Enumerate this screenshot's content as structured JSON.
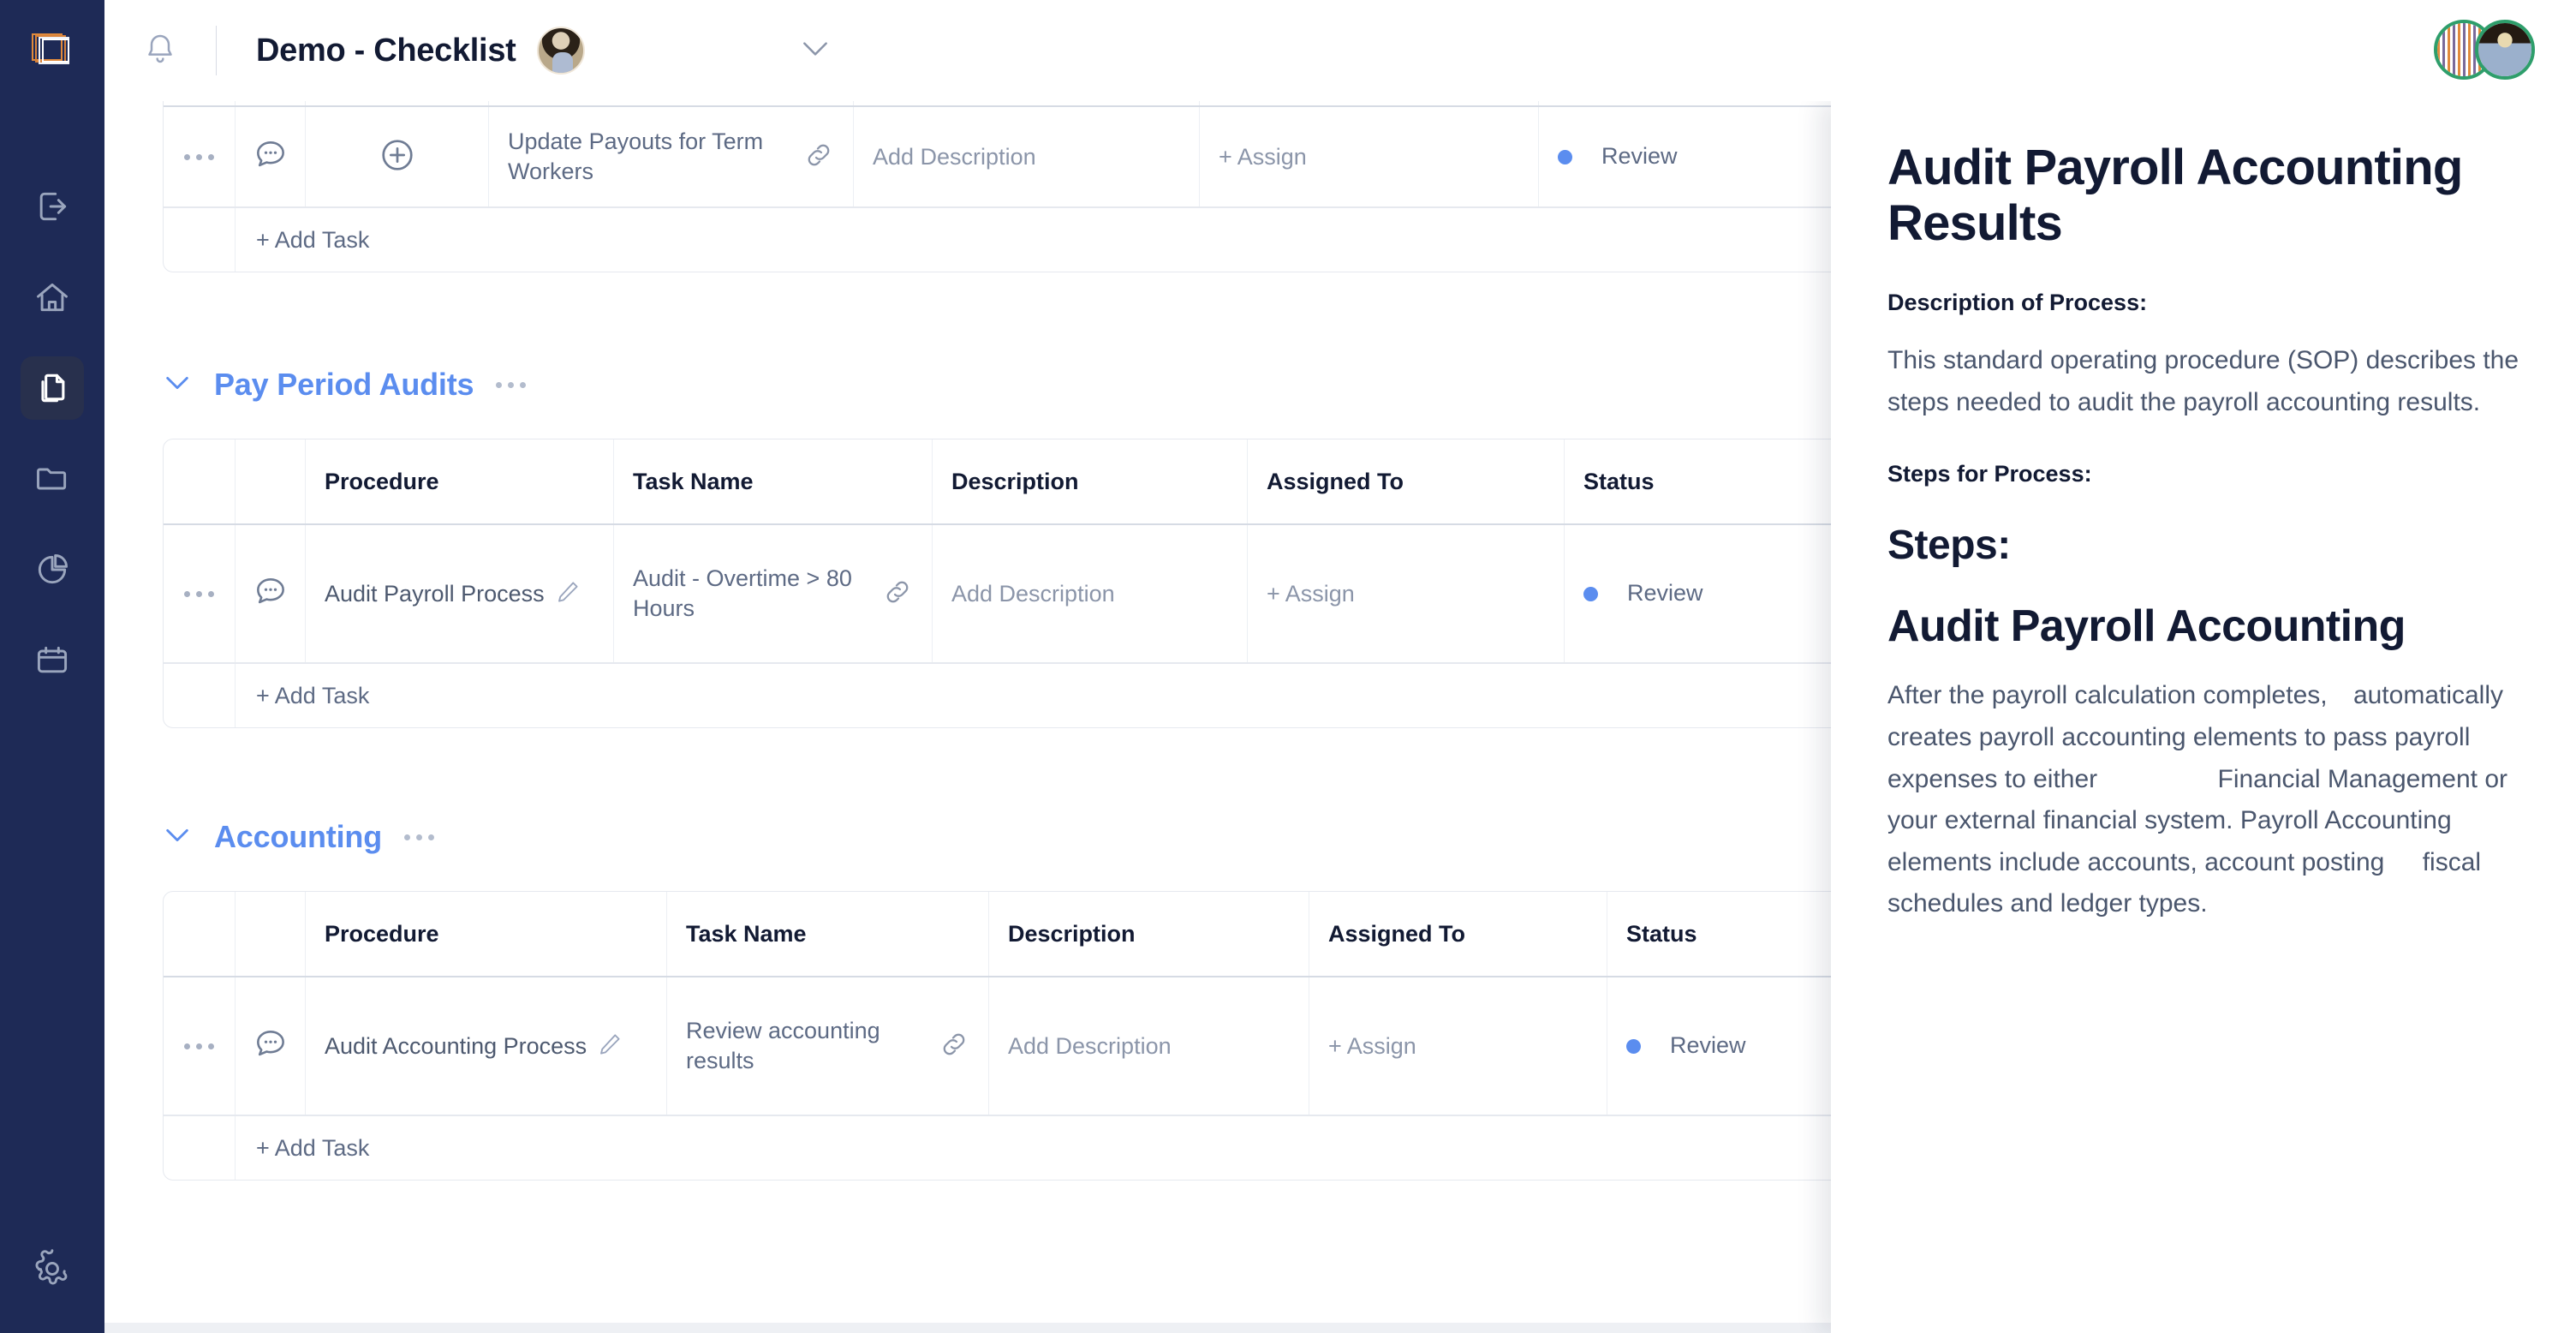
{
  "brand": {
    "accent": "#5b8def",
    "rail_bg": "#1e2a56",
    "logo_color": "#e08a3c",
    "status_color": "#5b8def",
    "avatar_ring": "#2e9e6b"
  },
  "topbar": {
    "bell_icon": "bell-icon",
    "title": "Demo - Checklist",
    "title_avatar": "user-avatar",
    "chevron_icon": "chevron-down-icon",
    "avatar_stack": [
      "workspace-avatar",
      "user-avatar"
    ]
  },
  "rail": {
    "logo": "app-logo-icon",
    "items": [
      {
        "icon": "logout-icon",
        "name": "sidebar-item-logout",
        "active": false
      },
      {
        "icon": "home-icon",
        "name": "sidebar-item-home",
        "active": false
      },
      {
        "icon": "documents-icon",
        "name": "sidebar-item-documents",
        "active": true
      },
      {
        "icon": "folder-icon",
        "name": "sidebar-item-folder",
        "active": false
      },
      {
        "icon": "pie-chart-icon",
        "name": "sidebar-item-reports",
        "active": false
      },
      {
        "icon": "calendar-icon",
        "name": "sidebar-item-calendar",
        "active": false
      }
    ],
    "settings": {
      "icon": "gear-icon",
      "name": "sidebar-item-settings"
    }
  },
  "table_columns": [
    "",
    "",
    "Procedure",
    "Task Name",
    "Description",
    "Assigned To",
    "Status"
  ],
  "labels": {
    "add_task": "+ Add Task",
    "add_description": "Add Description",
    "assign": "+ Assign",
    "link_icon": "link-icon",
    "chat_icon": "comment-icon",
    "plus_icon": "plus-circle-icon",
    "menu_icon": "more-options-icon",
    "pencil_icon": "edit-pencil-icon",
    "collapse_icon": "chevron-down-icon",
    "section_menu_icon": "more-options-icon"
  },
  "sections": [
    {
      "id": "top-partial",
      "title": "",
      "show_header": false,
      "has_plus_column": true,
      "rows": [
        {
          "procedure": "",
          "task_name": "Update Payouts for Term Workers",
          "description": "Add Description",
          "assigned_to": "+ Assign",
          "status": "Review"
        }
      ]
    },
    {
      "id": "pay-period-audits",
      "title": "Pay Period Audits",
      "show_header": true,
      "has_plus_column": false,
      "rows": [
        {
          "procedure": "Audit Payroll Process",
          "task_name": "Audit - Overtime > 80 Hours",
          "description": "Add Description",
          "assigned_to": "+ Assign",
          "status": "Review"
        }
      ]
    },
    {
      "id": "accounting",
      "title": "Accounting",
      "show_header": true,
      "has_plus_column": false,
      "rows": [
        {
          "procedure": "Audit Accounting Process",
          "task_name": "Review accounting results",
          "description": "Add Description",
          "assigned_to": "+ Assign",
          "status": "Review"
        }
      ]
    }
  ],
  "right_panel": {
    "title": "Audit Payroll Accounting Results",
    "description_label": "Description of Process:",
    "description_body": "This standard operating procedure (SOP) describes the steps needed to audit the payroll accounting results.",
    "steps_label": "Steps for Process:",
    "steps_heading": "Steps:",
    "section_heading": "Audit Payroll Accounting",
    "body_part_1": "After the payroll calculation completes,",
    "body_part_2": "automatically creates payroll accounting elements to pass payroll expenses to either",
    "body_part_3": "Financial Management or your external financial system. Payroll Accounting elements include accounts,",
    "body_part_4": "account posting",
    "body_part_5": "fiscal schedules and ledger types."
  }
}
